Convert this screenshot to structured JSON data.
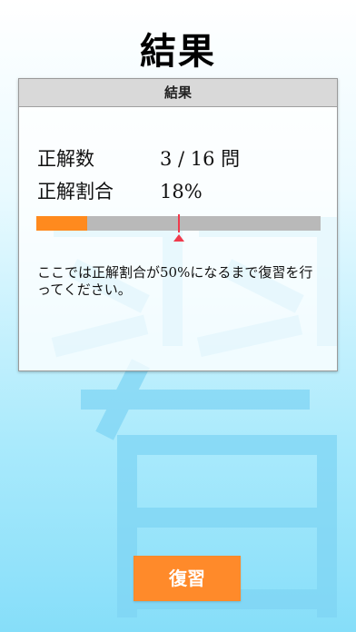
{
  "page": {
    "title": "結果"
  },
  "card": {
    "header": "結果",
    "correct_label": "正解数",
    "correct_value": "3 / 16 問",
    "rate_label": "正解割合",
    "rate_value": "18%",
    "progress_fraction": 0.18,
    "target_fraction": 0.5,
    "message": "ここでは正解割合が50%になるまで復習を行ってください。"
  },
  "review_button": {
    "label": "復習"
  },
  "colors": {
    "accent": "#ff8a2a",
    "progress_fill": "#ff8a1e",
    "progress_track": "#b9b9b9",
    "target_marker": "#f03a4c",
    "background_light": "#ffffff",
    "background_dark": "#86def9"
  },
  "background": {
    "decoration": "large-kanji-watermark"
  }
}
